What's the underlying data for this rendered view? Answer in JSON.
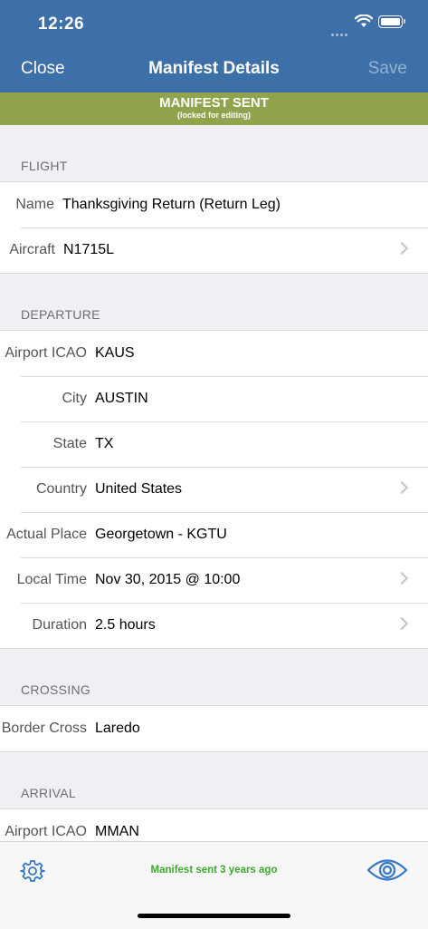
{
  "status_bar": {
    "time": "12:26"
  },
  "nav": {
    "close_label": "Close",
    "title": "Manifest Details",
    "save_label": "Save"
  },
  "banner": {
    "title": "MANIFEST SENT",
    "subtitle": "(locked for editing)",
    "color": "#8fa44c"
  },
  "sections": {
    "flight": {
      "header": "FLIGHT",
      "name_label": "Name",
      "name_value": "Thanksgiving Return (Return Leg)",
      "aircraft_label": "Aircraft",
      "aircraft_value": "N1715L"
    },
    "departure": {
      "header": "DEPARTURE",
      "airport_label": "Airport ICAO",
      "airport_value": "KAUS",
      "city_label": "City",
      "city_value": "AUSTIN",
      "state_label": "State",
      "state_value": "TX",
      "country_label": "Country",
      "country_value": "United States",
      "place_label": "Actual Place",
      "place_value": "Georgetown - KGTU",
      "time_label": "Local Time",
      "time_value": "Nov 30, 2015 @ 10:00",
      "duration_label": "Duration",
      "duration_value": "2.5 hours"
    },
    "crossing": {
      "header": "CROSSING",
      "border_label": "Border Cross",
      "border_value": "Laredo"
    },
    "arrival": {
      "header": "ARRIVAL",
      "airport_label": "Airport ICAO",
      "airport_value": "MMAN"
    }
  },
  "toolbar": {
    "status_text": "Manifest sent 3 years ago",
    "icons": [
      "gear-icon",
      "eye-icon"
    ]
  },
  "colors": {
    "nav_bg": "#3d6fa9",
    "accent": "#3478c6",
    "status_green": "#3ea92e"
  }
}
